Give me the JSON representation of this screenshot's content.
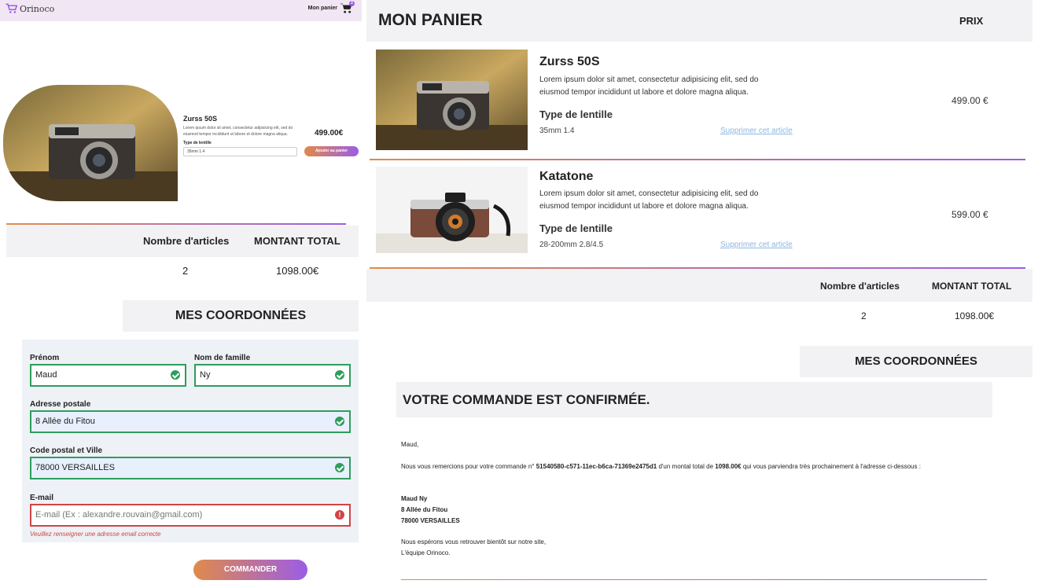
{
  "navbar": {
    "logo_text": "Orinoco",
    "cart_label": "Mon panier",
    "cart_count": "2"
  },
  "product_page": {
    "name": "Zurss 50S",
    "description": "Lorem ipsum dolor sit amet, consectetur adipisicing elit, sed do eiusmod tempor incididunt ut labore et dolore magna aliqua.",
    "lens_label": "Type de lentille",
    "lens_selected": "35mm 1.4",
    "price": "499.00€",
    "add_button": "Ajouter au panier"
  },
  "totals": {
    "count_header": "Nombre d'articles",
    "total_header": "MONTANT TOTAL",
    "count_value": "2",
    "total_value": "1098.00€"
  },
  "coords_title": "MES COORDONNÉES",
  "form": {
    "first_name_label": "Prénom",
    "first_name_value": "Maud",
    "last_name_label": "Nom de famille",
    "last_name_value": "Ny",
    "address_label": "Adresse postale",
    "address_value": "8 Allée du Fitou",
    "zip_label": "Code postal et Ville",
    "zip_value": "78000 VERSAILLES",
    "email_label": "E-mail",
    "email_placeholder": "E-mail (Ex : alexandre.rouvain@gmail.com)",
    "email_error": "Veuillez renseigner une adresse email correcte",
    "submit": "COMMANDER"
  },
  "cart": {
    "title": "MON PANIER",
    "price_header": "PRIX",
    "items": [
      {
        "name": "Zurss 50S",
        "description": "Lorem ipsum dolor sit amet, consectetur adipisicing elit, sed do eiusmod tempor incididunt ut labore et dolore magna aliqua.",
        "lens_label": "Type de lentille",
        "lens_value": "35mm 1.4",
        "remove_label": "Supprimer cet article",
        "price": "499.00 €"
      },
      {
        "name": "Katatone",
        "description": "Lorem ipsum dolor sit amet, consectetur adipisicing elit, sed do eiusmod tempor incididunt ut labore et dolore magna aliqua.",
        "lens_label": "Type de lentille",
        "lens_value": "28-200mm 2.8/4.5",
        "remove_label": "Supprimer cet article",
        "price": "599.00 €"
      }
    ]
  },
  "confirmation": {
    "title": "VOTRE COMMANDE EST CONFIRMÉE.",
    "greeting": "Maud,",
    "thanks_part1": "Nous vous remercions pour votre commande n°",
    "order_id": "51540580-c571-11ec-b6ca-71369e2475d1",
    "thanks_part2": "d'un montal total de",
    "order_total": "1098.00€",
    "thanks_part3": "qui vous parviendra très prochainement à l'adresse ci-dessous :",
    "address_name": "Maud Ny",
    "address_street": "8 Allée du Fitou",
    "address_city": "78000 VERSAILLES",
    "closing_line1": "Nous espérons vous retrouver bientôt sur notre site,",
    "closing_line2": "L'équipe Orinoco."
  },
  "colors": {
    "gradient_start": "#e08a4a",
    "gradient_end": "#9b5de5",
    "navbar_bg": "#f1e6f3",
    "valid_green": "#2e9e5b",
    "error_red": "#d04545",
    "link_blue": "#8cb6e0"
  }
}
